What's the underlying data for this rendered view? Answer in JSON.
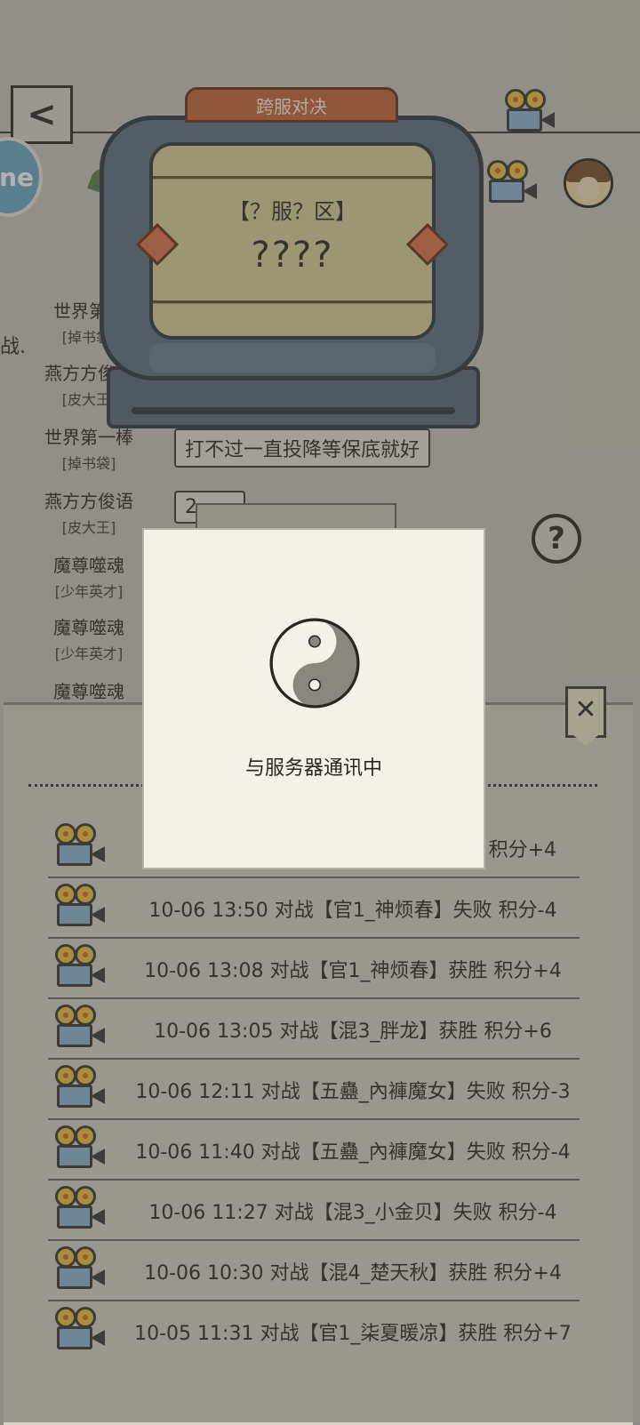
{
  "header": {
    "back_glyph": "<",
    "logo_text": "ne",
    "side_text": "战."
  },
  "ranking": [
    {
      "name": "世界第一",
      "title": "[掉书袋]"
    },
    {
      "name": "燕方方俊语",
      "title": "[皮大王]"
    },
    {
      "name": "世界第一棒",
      "title": "[掉书袋]"
    },
    {
      "name": "燕方方俊语",
      "title": "[皮大王]"
    },
    {
      "name": "魔尊噬魂",
      "title": "[少年英才]"
    },
    {
      "name": "魔尊噬魂",
      "title": "[少年英才]"
    },
    {
      "name": "魔尊噬魂",
      "title": ""
    }
  ],
  "speech": {
    "line1": "打不过一直投降等保底就好",
    "line2": "2"
  },
  "help_glyph": "?",
  "machine": {
    "tab_label": "跨服对决",
    "region": "【？服？区】",
    "opponent": "????"
  },
  "records": {
    "close_glyph": "✕",
    "items": [
      {
        "text": "积分+4"
      },
      {
        "text": "10-06 13:50 对战【官1_神烦春】失败 积分-4"
      },
      {
        "text": "10-06 13:08 对战【官1_神烦春】获胜 积分+4"
      },
      {
        "text": "10-06 13:05 对战【混3_胖龙】获胜 积分+6"
      },
      {
        "text": "10-06 12:11 对战【五蠱_內褲魔女】失败 积分-3"
      },
      {
        "text": "10-06 11:40 对战【五蠱_內褲魔女】失败 积分-4"
      },
      {
        "text": "10-06 11:27 对战【混3_小金贝】失败 积分-4"
      },
      {
        "text": "10-06 10:30 对战【混4_楚天秋】获胜 积分+4"
      },
      {
        "text": "10-05 11:31 对战【官1_柒夏暖凉】获胜 积分+7"
      }
    ]
  },
  "dialog": {
    "message": "与服务器通讯中"
  },
  "colors": {
    "machine_body": "#5d6e82",
    "machine_tab": "#c76436",
    "screen": "#ddd19b",
    "panel": "#d7d2c7"
  }
}
